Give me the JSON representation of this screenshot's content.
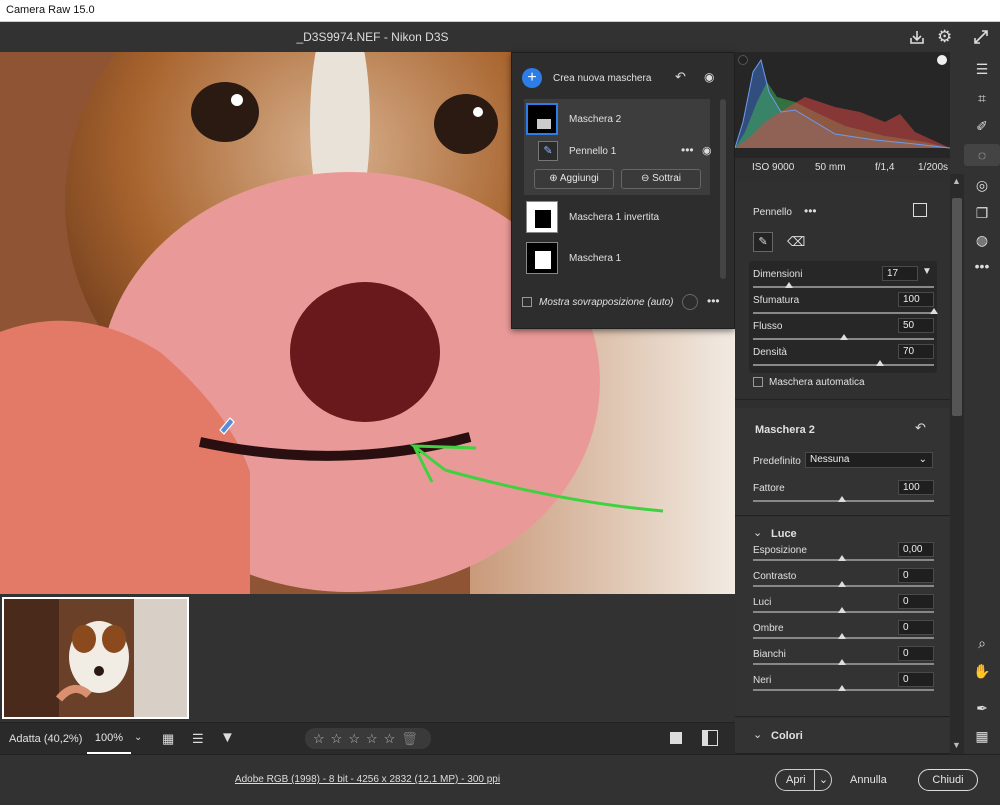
{
  "app": {
    "window_title": "Camera Raw 15.0",
    "file_title": "_D3S9974.NEF  -  Nikon D3S"
  },
  "exif": {
    "iso": "ISO 9000",
    "focal": "50 mm",
    "aperture": "f/1,4",
    "shutter": "1/200s"
  },
  "mask_panel": {
    "create_label": "Crea nuova maschera",
    "mask2": "Maschera 2",
    "brush1": "Pennello 1",
    "add": "Aggiungi",
    "subtract": "Sottrai",
    "mask1_inv": "Maschera 1 invertita",
    "mask1": "Maschera 1",
    "overlay": "Mostra sovrapposizione (auto)"
  },
  "brush": {
    "title": "Pennello",
    "size_label": "Dimensioni",
    "size": "17",
    "feather_label": "Sfumatura",
    "feather": "100",
    "flow_label": "Flusso",
    "flow": "50",
    "density_label": "Densità",
    "density": "70",
    "automask": "Maschera automatica",
    "size_pct": 0.2,
    "feather_pct": 1.0,
    "flow_pct": 0.5,
    "density_pct": 0.7
  },
  "mask_section": {
    "title": "Maschera 2",
    "preset_label": "Predefinito",
    "preset": "Nessuna",
    "amount_label": "Fattore",
    "amount": "100"
  },
  "light": {
    "title": "Luce",
    "items": [
      {
        "label": "Esposizione",
        "value": "0,00"
      },
      {
        "label": "Contrasto",
        "value": "0"
      },
      {
        "label": "Luci",
        "value": "0"
      },
      {
        "label": "Ombre",
        "value": "0"
      },
      {
        "label": "Bianchi",
        "value": "0"
      },
      {
        "label": "Neri",
        "value": "0"
      }
    ]
  },
  "colors_title": "Colori",
  "zoom": {
    "fit": "Adatta (40,2%)",
    "pct": "100%"
  },
  "footer": {
    "info": "Adobe RGB (1998) - 8 bit - 4256 x 2832 (12,1 MP) - 300 ppi",
    "open": "Apri",
    "cancel": "Annulla",
    "done": "Chiudi"
  },
  "colors": {
    "accent": "#2d7de8",
    "overlay": "#e05050",
    "arrow": "#3fd13f"
  }
}
